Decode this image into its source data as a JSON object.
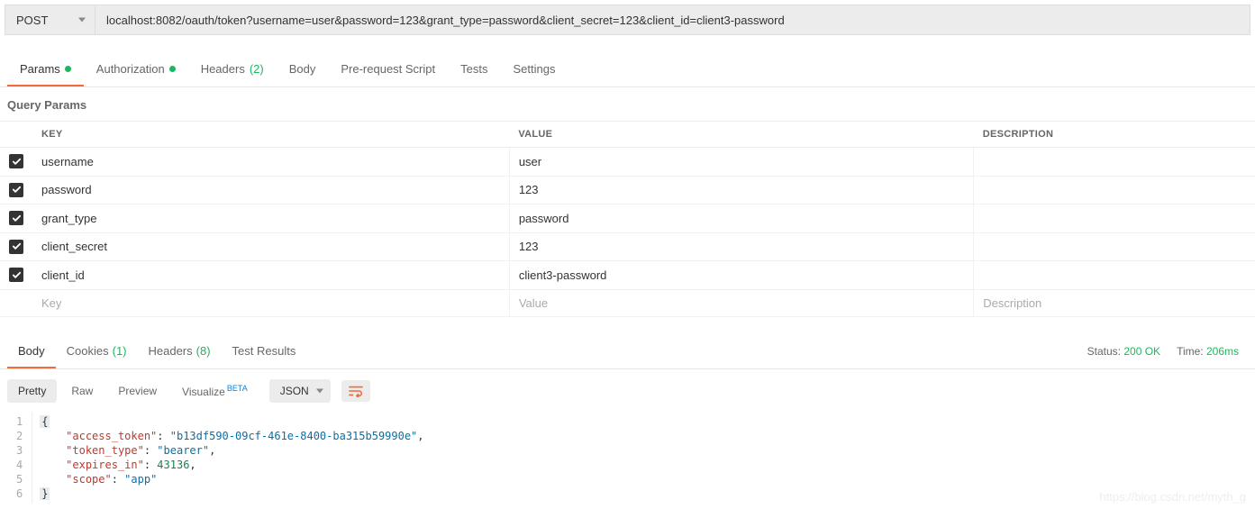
{
  "request": {
    "method": "POST",
    "url": "localhost:8082/oauth/token?username=user&password=123&grant_type=password&client_secret=123&client_id=client3-password"
  },
  "requestTabs": {
    "params": "Params",
    "authorization": "Authorization",
    "headers": "Headers",
    "headers_count": "(2)",
    "body": "Body",
    "prerequest": "Pre-request Script",
    "tests": "Tests",
    "settings": "Settings"
  },
  "sectionTitle": "Query Params",
  "tableHeaders": {
    "key": "KEY",
    "value": "VALUE",
    "description": "DESCRIPTION"
  },
  "params": [
    {
      "key": "username",
      "value": "user"
    },
    {
      "key": "password",
      "value": "123"
    },
    {
      "key": "grant_type",
      "value": "password"
    },
    {
      "key": "client_secret",
      "value": "123"
    },
    {
      "key": "client_id",
      "value": "client3-password"
    }
  ],
  "placeholderRow": {
    "key": "Key",
    "value": "Value",
    "description": "Description"
  },
  "responseTabs": {
    "body": "Body",
    "cookies": "Cookies",
    "cookies_count": "(1)",
    "headers": "Headers",
    "headers_count": "(8)",
    "testresults": "Test Results"
  },
  "responseMeta": {
    "status_label": "Status:",
    "status_value": "200 OK",
    "time_label": "Time:",
    "time_value": "206ms"
  },
  "bodyToolbar": {
    "pretty": "Pretty",
    "raw": "Raw",
    "preview": "Preview",
    "visualize": "Visualize",
    "beta": "BETA",
    "format": "JSON"
  },
  "responseBody": {
    "access_token_key": "\"access_token\"",
    "access_token_val": "\"b13df590-09cf-461e-8400-ba315b59990e\"",
    "token_type_key": "\"token_type\"",
    "token_type_val": "\"bearer\"",
    "expires_in_key": "\"expires_in\"",
    "expires_in_val": "43136",
    "scope_key": "\"scope\"",
    "scope_val": "\"app\""
  },
  "lineNumbers": [
    "1",
    "2",
    "3",
    "4",
    "5",
    "6"
  ],
  "watermark": "https://blog.csdn.net/myth_g"
}
